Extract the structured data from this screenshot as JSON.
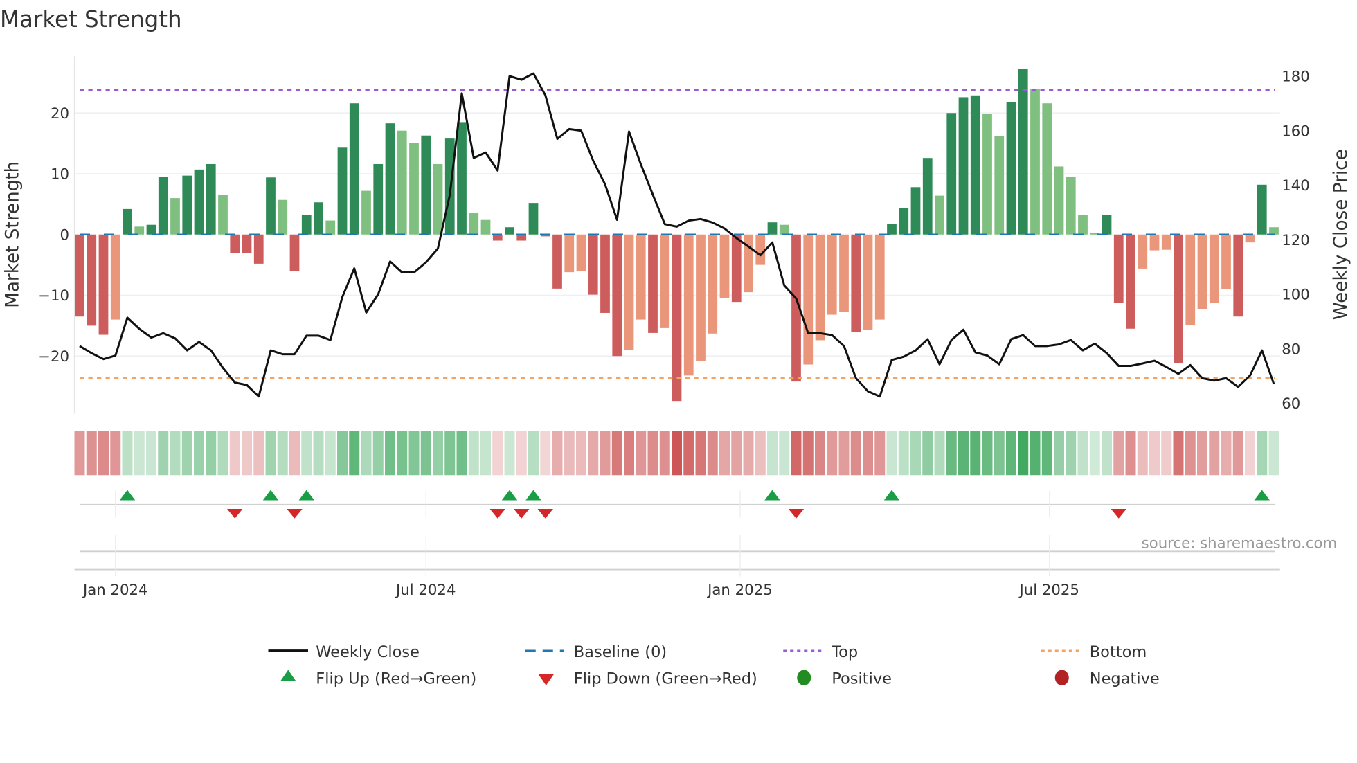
{
  "title": "Market Strength",
  "source": "source: sharemaestro.com",
  "colors": {
    "bar_pos_strong": "#2e8b57",
    "bar_pos_weak": "#7fbf7f",
    "bar_neg_strong": "#cd5c5c",
    "bar_neg_weak": "#e9967a",
    "line": "#111111",
    "baseline": "#1f77b4",
    "top": "#9b59d6",
    "bottom": "#f4a460",
    "flip_up": "#1a9e45",
    "flip_down": "#d62728",
    "positive": "#228b22",
    "negative": "#b22222"
  },
  "legend": {
    "weekly_close": "Weekly Close",
    "baseline": "Baseline (0)",
    "top": "Top",
    "bottom": "Bottom",
    "flip_up": "Flip Up (Red→Green)",
    "flip_down": "Flip Down (Green→Red)",
    "positive": "Positive",
    "negative": "Negative"
  },
  "chart_data": {
    "type": "bar",
    "title": "Market Strength",
    "ylabel": "Market Strength",
    "y2label": "Weekly Close Price",
    "ylim": [
      -29.6,
      29.4
    ],
    "y2lim": [
      56,
      186
    ],
    "yticks": [
      {
        "v": 20,
        "label": "20"
      },
      {
        "v": 10,
        "label": "10"
      },
      {
        "v": 0,
        "label": "0"
      },
      {
        "v": -10,
        "label": "−10"
      },
      {
        "v": -20,
        "label": "−20"
      }
    ],
    "y2ticks": [
      {
        "v": 180,
        "label": "180"
      },
      {
        "v": 160,
        "label": "160"
      },
      {
        "v": 140,
        "label": "140"
      },
      {
        "v": 120,
        "label": "120"
      },
      {
        "v": 100,
        "label": "100"
      },
      {
        "v": 80,
        "label": "80"
      },
      {
        "v": 60,
        "label": "60"
      }
    ],
    "xticks": [
      {
        "week": 3,
        "label": "Jan 2024"
      },
      {
        "week": 29,
        "label": "Jul 2024"
      },
      {
        "week": 55.3,
        "label": "Jan 2025"
      },
      {
        "week": 81.2,
        "label": "Jul 2025"
      }
    ],
    "top_level": 23.8,
    "bottom_level": -23.6,
    "strength": [
      -13.5,
      -15,
      -16.5,
      -14,
      4.2,
      1.3,
      1.6,
      9.5,
      6,
      9.7,
      10.7,
      11.6,
      6.5,
      -3,
      -3.1,
      -4.8,
      9.4,
      5.7,
      -6,
      3.2,
      5.3,
      2.3,
      14.3,
      21.6,
      7.2,
      11.6,
      18.3,
      17.1,
      15.1,
      16.3,
      11.6,
      15.8,
      18.5,
      3.5,
      2.4,
      -1,
      1.2,
      -1,
      5.2,
      -0.3,
      -8.9,
      -6.2,
      -6,
      -9.9,
      -12.9,
      -20,
      -19,
      -14,
      -16.2,
      -15.4,
      -27.4,
      -23.2,
      -20.8,
      -16.3,
      -10.4,
      -11.1,
      -9.5,
      -5,
      2,
      1.6,
      -24.2,
      -21.4,
      -17.4,
      -13.2,
      -12.7,
      -16.1,
      -15.7,
      -14,
      1.7,
      4.3,
      7.8,
      12.6,
      6.4,
      20,
      22.6,
      22.9,
      19.8,
      16.2,
      21.8,
      27.3,
      24,
      21.6,
      11.2,
      9.5,
      3.2,
      0.2,
      3.2,
      -11.2,
      -15.5,
      -5.6,
      -2.6,
      -2.5,
      -21.2,
      -14.9,
      -12.3,
      -11.3,
      -9,
      -13.5,
      -1.3,
      8.2,
      1.2
    ],
    "weekly_close": [
      81,
      78.4,
      76.2,
      77.5,
      91.4,
      87.3,
      84.1,
      85.7,
      83.8,
      79.4,
      82.5,
      79.4,
      73,
      67.6,
      66.7,
      62.5,
      79.4,
      78,
      78,
      84.8,
      84.8,
      83.2,
      99,
      109.5,
      93.3,
      100,
      112,
      108,
      108,
      111.7,
      116.8,
      136.5,
      173.7,
      150,
      152,
      145.4,
      180,
      178.7,
      181,
      173,
      157,
      160.6,
      160,
      149,
      140.3,
      127.3,
      159.7,
      147.6,
      136.5,
      125.7,
      124.8,
      127,
      127.6,
      126.3,
      124.1,
      120.6,
      117.5,
      114.3,
      119,
      103.2,
      98.4,
      85.7,
      85.7,
      85,
      81,
      69.2,
      64.4,
      62.5,
      75.9,
      77.1,
      79.4,
      83.5,
      74.3,
      83.2,
      87,
      78.7,
      77.5,
      74.3,
      83.5,
      85,
      81,
      81,
      81.6,
      83.2,
      79.4,
      81.9,
      78.4,
      73.7,
      73.7,
      74.6,
      75.6,
      73.3,
      70.8,
      74,
      69.2,
      68.3,
      69.2,
      66,
      70.2,
      79.4,
      67
    ]
  }
}
